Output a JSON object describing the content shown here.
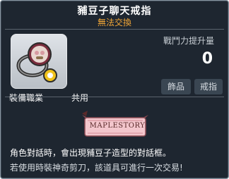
{
  "item": {
    "name": "豧豆子聊天戒指",
    "trade_status": "無法交換",
    "power_label": "戰鬥力提升量",
    "power_value": "0",
    "tags": [
      "飾品",
      "戒指"
    ],
    "job_label": "裝備職業",
    "job_value": "共用",
    "badge_text": "MAPLESTORY",
    "description_line1": "角色對話時，會出現豧豆子造型的對話框。",
    "description_line2": "若使用時裝神奇剪刀，該道具可進行一次交易!"
  },
  "colors": {
    "background": "#1e2630",
    "title": "#ffffff",
    "subtitle": "#f1a637",
    "badge_pink": "#f3c6cc"
  },
  "icons": [
    "ring-icon"
  ]
}
